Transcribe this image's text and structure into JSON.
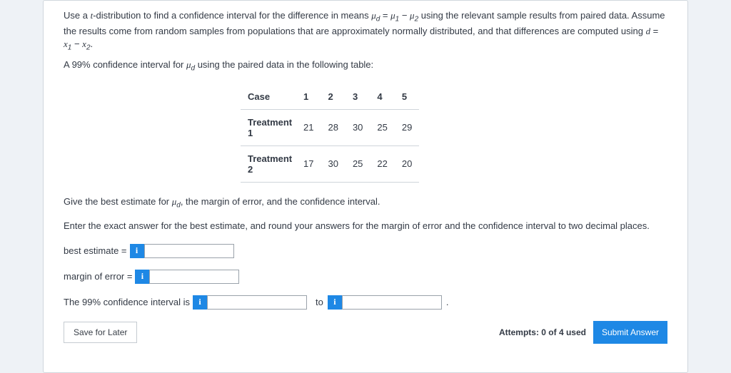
{
  "intro": {
    "p1_a": "Use a ",
    "p1_b": "t",
    "p1_c": "-distribution to find a confidence interval for the difference in means ",
    "p1_d": "μ",
    "p1_dsub": "d",
    "p1_e": " = ",
    "p1_f": "μ",
    "p1_fsub": "1",
    "p1_g": " − ",
    "p1_h": "μ",
    "p1_hsub": "2",
    "p1_i": " using the relevant sample results from paired data. Assume the results come from random samples from populations that are approximately normally distributed, and that differences are computed using ",
    "p1_j": "d",
    "p1_k": " = ",
    "p1_l": "x",
    "p1_lsub": "1",
    "p1_m": " − ",
    "p1_n": "x",
    "p1_nsub": "2",
    "p1_o": ".",
    "p2_a": "A 99% confidence interval for ",
    "p2_b": "μ",
    "p2_bsub": "d",
    "p2_c": " using the paired data in the following table:"
  },
  "table": {
    "header": [
      "Case",
      "1",
      "2",
      "3",
      "4",
      "5"
    ],
    "rows": [
      {
        "label": "Treatment 1",
        "vals": [
          "21",
          "28",
          "30",
          "25",
          "29"
        ]
      },
      {
        "label": "Treatment 2",
        "vals": [
          "17",
          "30",
          "25",
          "22",
          "20"
        ]
      }
    ]
  },
  "chart_data": {
    "type": "table",
    "categories": [
      "1",
      "2",
      "3",
      "4",
      "5"
    ],
    "series": [
      {
        "name": "Treatment 1",
        "values": [
          21,
          28,
          30,
          25,
          29
        ]
      },
      {
        "name": "Treatment 2",
        "values": [
          17,
          30,
          25,
          22,
          20
        ]
      }
    ]
  },
  "prompt": {
    "p1_a": "Give the best estimate for ",
    "p1_b": "μ",
    "p1_bsub": "d",
    "p1_c": ", the margin of error, and the confidence interval.",
    "p2": "Enter the exact answer for the best estimate, and round your answers for the margin of error and the confidence interval to two decimal places."
  },
  "fields": {
    "best_label": "best estimate = ",
    "margin_label": "margin of error = ",
    "ci_label": "The 99% confidence interval is ",
    "to": " to ",
    "period": ".",
    "best_value": "",
    "margin_value": "",
    "ci_low_value": "",
    "ci_high_value": ""
  },
  "footer": {
    "save": "Save for Later",
    "attempts": "Attempts: 0 of 4 used",
    "submit": "Submit Answer"
  },
  "info_glyph": "i"
}
